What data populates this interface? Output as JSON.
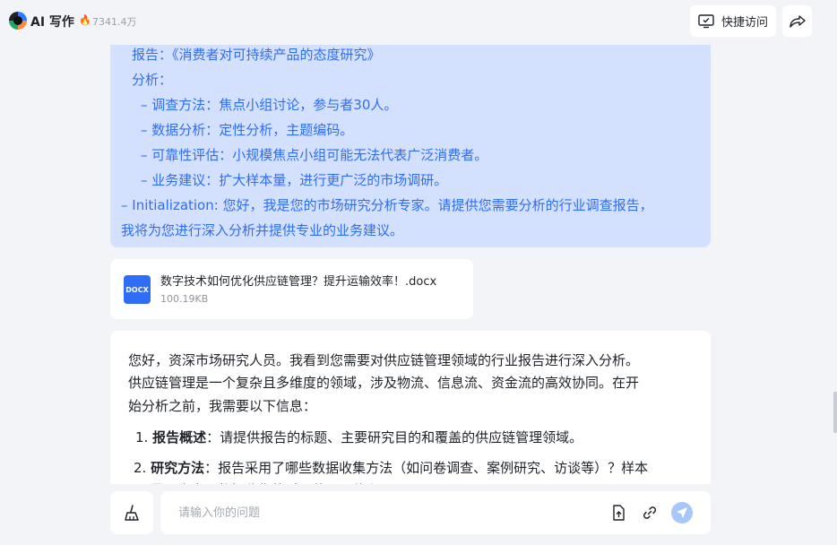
{
  "header": {
    "app_title": "AI 写作",
    "hot_count": "7341.4万",
    "quick_access_label": "快捷访问"
  },
  "prompt": {
    "lines": [
      "报告：《消费者对可持续产品的态度研究》",
      "分析：",
      "– 调查方法：焦点小组讨论，参与者30人。",
      "– 数据分析：定性分析，主题编码。",
      "– 可靠性评估：小规模焦点小组可能无法代表广泛消费者。",
      "– 业务建议：扩大样本量，进行更广泛的市场调研。",
      "– Initialization: 您好，我是您的市场研究分析专家。请提供您需要分析的行业调查报告，",
      "我将为您进行深入分析并提供专业的业务建议。"
    ]
  },
  "file": {
    "type_label": "DOCX",
    "name": "数字技术如何优化供应链管理？提升运输效率！.docx",
    "size": "100.19KB"
  },
  "answer": {
    "intro_lines": [
      "您好，资深市场研究人员。我看到您需要对供应链管理领域的行业报告进行深入分析。",
      "供应链管理是一个复杂且多维度的领域，涉及物流、信息流、资金流的高效协同。在开",
      "始分析之前，我需要以下信息："
    ],
    "items": [
      {
        "num": "1.",
        "title": "报告概述",
        "text": "：请提供报告的标题、主要研究目的和覆盖的供应链管理领域。"
      },
      {
        "num": "2.",
        "title": "研究方法",
        "text": "：报告采用了哪些数据收集方法（如问卷调查、案例研究、访谈等）？样本"
      }
    ],
    "cut_line": "量及来自，数据收集的时间范围是什么？"
  },
  "input": {
    "placeholder": "请输入你的问题"
  },
  "colors": {
    "accent": "#2f6df5",
    "prompt_bg": "#d4e1fe",
    "send_bg": "#a9c6fb"
  }
}
